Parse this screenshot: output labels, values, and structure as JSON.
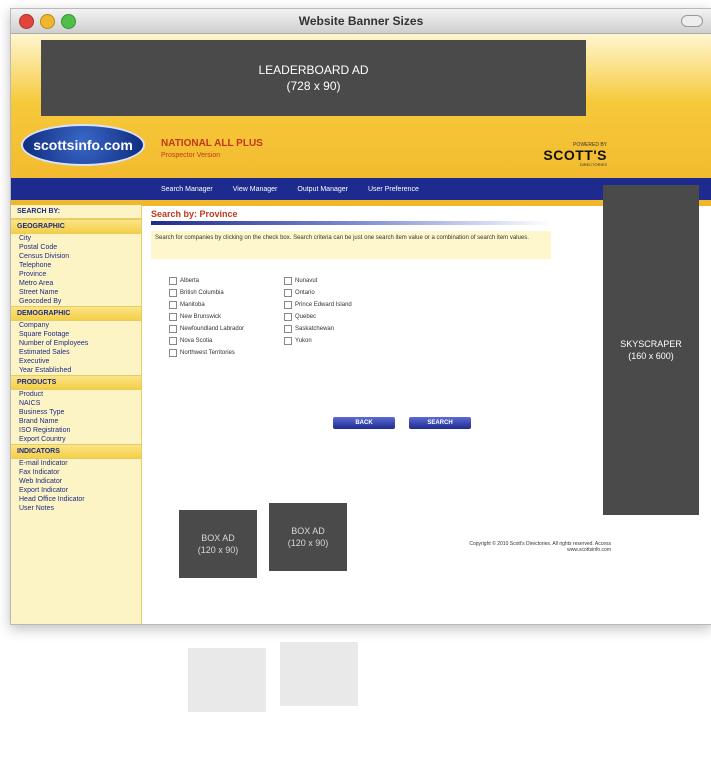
{
  "window": {
    "title": "Website Banner Sizes"
  },
  "ads": {
    "leaderboard_name": "LEADERBOARD AD",
    "leaderboard_size": "(728 x 90)",
    "skyscraper_name": "SKYSCRAPER",
    "skyscraper_size": "(160 x 600)",
    "box1_name": "BOX AD",
    "box1_size": "(120 x 90)",
    "box2_name": "BOX AD",
    "box2_size": "(120 x 90)"
  },
  "header": {
    "logo_text": "scottsinfo.com",
    "product_title": "NATIONAL ALL PLUS",
    "product_subtitle": "Prospector Version",
    "brand_small": "POWERED BY",
    "brand_name": "SCOTT'S",
    "brand_sub": "DIRECTORIES"
  },
  "nav": {
    "items": [
      "Search Manager",
      "View Manager",
      "Output Manager",
      "User Preference"
    ]
  },
  "sidebar": {
    "search_by": "SEARCH BY:",
    "geographic": "GEOGRAPHIC",
    "geographic_items": [
      "City",
      "Postal Code",
      "Census Division",
      "Telephone",
      "Province",
      "Metro Area",
      "Street Name",
      "Geocoded By"
    ],
    "demographic": "DEMOGRAPHIC",
    "demographic_items": [
      "Company",
      "Square Footage",
      "Number of Employees",
      "Estimated Sales",
      "Executive",
      "Year Established"
    ],
    "products": "PRODUCTS",
    "products_items": [
      "Product",
      "NAICS",
      "Business Type",
      "Brand Name",
      "ISO Registration",
      "Export Country"
    ],
    "indicators": "INDICATORS",
    "indicators_items": [
      "E-mail Indicator",
      "Fax Indicator",
      "Web Indicator",
      "Export Indicator",
      "Head Office Indicator",
      "User Notes"
    ]
  },
  "content": {
    "title": "Search by: Province",
    "instructions": "Search for companies by clicking on the check box. Search criteria can be just one search item value or a combination of search item values.",
    "provinces_left": [
      "Alberta",
      "British Columbia",
      "Manitoba",
      "New Brunswick",
      "Newfoundland Labrador",
      "Nova Scotia",
      "Northwest Territories"
    ],
    "provinces_right": [
      "Nunavut",
      "Ontario",
      "Prince Edward Island",
      "Quebec",
      "Saskatchewan",
      "Yukon"
    ],
    "back_label": "BACK",
    "search_label": "SEARCH",
    "copyright": "Copyright © 2010 Scott's Directories. All rights reserved. Access www.scottsinfo.com"
  }
}
